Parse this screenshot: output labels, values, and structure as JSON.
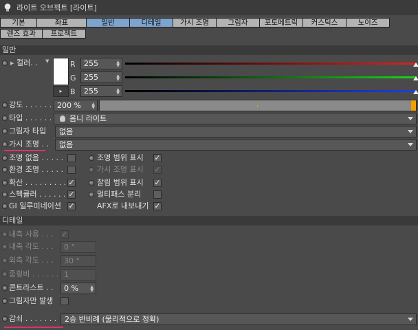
{
  "window": {
    "title": "라이트 오브젝트 [라이트]"
  },
  "tabs_row1": [
    {
      "label": "기본",
      "active": false
    },
    {
      "label": "좌표",
      "active": false
    },
    {
      "label": "일반",
      "active": true
    },
    {
      "label": "디테일",
      "active": true
    },
    {
      "label": "가시 조명",
      "active": false
    },
    {
      "label": "그림자",
      "active": false
    },
    {
      "label": "포토메트릭",
      "active": false
    },
    {
      "label": "커스틱스",
      "active": false
    },
    {
      "label": "노이즈",
      "active": false
    }
  ],
  "tabs_row2": [
    {
      "label": "렌즈 효과"
    },
    {
      "label": "프로젝트"
    }
  ],
  "general": {
    "section_title": "일반",
    "color": {
      "label": "컬러. .",
      "swatch": "#ffffff",
      "r_label": "R",
      "r_value": "255",
      "g_label": "G",
      "g_value": "255",
      "b_label": "B",
      "b_value": "255"
    },
    "intensity": {
      "label": "강도 . . . . . .",
      "value": "200 %",
      "fill_fraction": 1.0
    },
    "type": {
      "label": "타입 . . . . . . .",
      "value": "옴니 라이트",
      "icon": "bulb-icon"
    },
    "shadow_type": {
      "label": "그림자 타입",
      "value": "없음"
    },
    "visible_light": {
      "label": "가시 조명 . .",
      "value": "없음"
    },
    "checks_left": [
      {
        "label": "조명 없음 . . . . .",
        "checked": false,
        "dim": false
      },
      {
        "label": "환경 조명 . . . . .",
        "checked": false,
        "dim": false
      },
      {
        "label": "확산 . . . . . . . . . .",
        "checked": true,
        "dim": false
      },
      {
        "label": "스펙큘러 . . . . . . .",
        "checked": true,
        "dim": false
      },
      {
        "label": "GI 일루미네이션",
        "checked": true,
        "dim": false
      }
    ],
    "checks_right": [
      {
        "label": "조명 범위 표시",
        "checked": true,
        "dim": false
      },
      {
        "label": "가시 조명 표시",
        "checked": true,
        "dim": true
      },
      {
        "label": "잘림 범위 표시",
        "checked": true,
        "dim": false
      },
      {
        "label": "멀티패스 분리",
        "checked": false,
        "dim": false
      },
      {
        "label": "AFX로 내보내기",
        "checked": true,
        "dim": false
      }
    ]
  },
  "detail": {
    "section_title": "디테일",
    "use_inner": {
      "label": "내측 사용 . . .",
      "checked": true,
      "dim": true
    },
    "inner_angle": {
      "label": "내측 각도 . . .",
      "value": "0 °",
      "dim": true
    },
    "outer_angle": {
      "label": "외측 각도 . . .",
      "value": "30 °",
      "dim": true
    },
    "aspect_ratio": {
      "label": "종횡비 . . . . . .",
      "value": "1",
      "dim": true
    },
    "contrast": {
      "label": "콘트라스트 . .",
      "value": "0 %",
      "dim": false
    },
    "shadow_caster": {
      "label": "그림자만 발생",
      "checked": false,
      "dim": false
    },
    "falloff": {
      "label": "감쇠 . . . . . . .",
      "value": "2승 반비례 (물리적으로 정확)"
    }
  },
  "colors": {
    "tab_active": "#7ea3cc",
    "tab_inactive": "#b3b3b3",
    "intensity_fill": "#f0a000",
    "underline": "#e0316d",
    "red": "#e02020",
    "green": "#20d020",
    "blue": "#2040e0"
  }
}
